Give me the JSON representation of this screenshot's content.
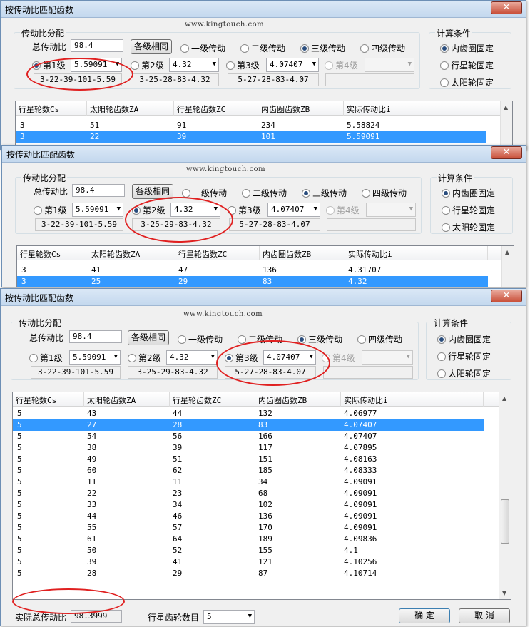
{
  "window_title": "按传动比匹配齿数",
  "url_text": "www.kingtouch.com",
  "group_ratio_label": "传动比分配",
  "group_calc_label": "计算条件",
  "total_ratio_label": "总传动比",
  "total_ratio_value": "98.4",
  "equal_stages_button": "各级相同",
  "stage_count_options": [
    "一级传动",
    "二级传动",
    "三级传动",
    "四级传动"
  ],
  "stage_labels": [
    "第1级",
    "第2级",
    "第3级",
    "第4级"
  ],
  "calc_options": [
    "内齿圈固定",
    "行星轮固定",
    "太阳轮固定"
  ],
  "column_headers": [
    "行星轮数Cs",
    "太阳轮齿数ZA",
    "行星轮齿数ZC",
    "内齿圈齿数ZB",
    "实际传动比i"
  ],
  "win1": {
    "stage_values": [
      "5.59091",
      "4.32",
      "4.07407",
      ""
    ],
    "stage_results": [
      "3-22-39-101-5.59",
      "3-25-28-83-4.32",
      "5-27-28-83-4.07",
      ""
    ],
    "rows": [
      [
        "3",
        "51",
        "91",
        "234",
        "5.58824"
      ],
      [
        "3",
        "22",
        "39",
        "101",
        "5.59091"
      ]
    ]
  },
  "win2": {
    "stage_values": [
      "5.59091",
      "4.32",
      "4.07407",
      ""
    ],
    "stage_results": [
      "3-22-39-101-5.59",
      "3-25-29-83-4.32",
      "5-27-28-83-4.07",
      ""
    ],
    "rows": [
      [
        "3",
        "41",
        "47",
        "136",
        "4.31707"
      ],
      [
        "3",
        "25",
        "29",
        "83",
        "4.32"
      ]
    ]
  },
  "win3": {
    "stage_values": [
      "5.59091",
      "4.32",
      "4.07407",
      ""
    ],
    "stage_results": [
      "3-22-39-101-5.59",
      "3-25-29-83-4.32",
      "5-27-28-83-4.07",
      ""
    ],
    "rows": [
      [
        "5",
        "43",
        "44",
        "132",
        "4.06977"
      ],
      [
        "5",
        "27",
        "28",
        "83",
        "4.07407"
      ],
      [
        "5",
        "54",
        "56",
        "166",
        "4.07407"
      ],
      [
        "5",
        "38",
        "39",
        "117",
        "4.07895"
      ],
      [
        "5",
        "49",
        "51",
        "151",
        "4.08163"
      ],
      [
        "5",
        "60",
        "62",
        "185",
        "4.08333"
      ],
      [
        "5",
        "11",
        "11",
        "34",
        "4.09091"
      ],
      [
        "5",
        "22",
        "23",
        "68",
        "4.09091"
      ],
      [
        "5",
        "33",
        "34",
        "102",
        "4.09091"
      ],
      [
        "5",
        "44",
        "46",
        "136",
        "4.09091"
      ],
      [
        "5",
        "55",
        "57",
        "170",
        "4.09091"
      ],
      [
        "5",
        "61",
        "64",
        "189",
        "4.09836"
      ],
      [
        "5",
        "50",
        "52",
        "155",
        "4.1"
      ],
      [
        "5",
        "39",
        "41",
        "121",
        "4.10256"
      ],
      [
        "5",
        "28",
        "29",
        "87",
        "4.10714"
      ]
    ],
    "actual_total_label": "实际总传动比",
    "actual_total_value": "98.3999",
    "planet_count_label": "行星齿轮数目",
    "planet_count_value": "5",
    "ok_button": "确 定",
    "cancel_button": "取 消"
  }
}
